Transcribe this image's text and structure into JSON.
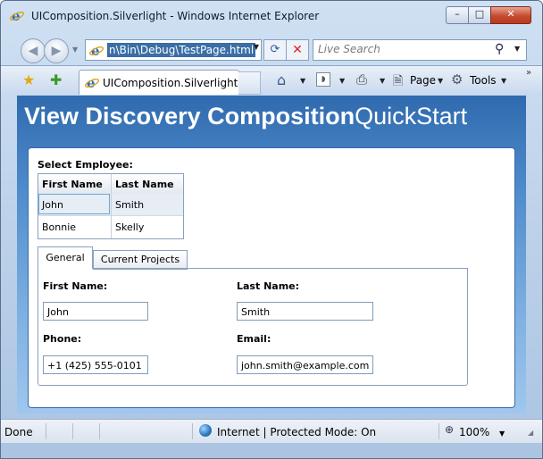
{
  "window": {
    "title": "UIComposition.Silverlight - Windows Internet Explorer",
    "controls": {
      "minimize": "–",
      "maximize": "□",
      "close": "✕"
    }
  },
  "navigation": {
    "back_glyph": "◀",
    "forward_glyph": "▶",
    "address": "n\\Bin\\Debug\\TestPage.html",
    "refresh_glyph": "⟳",
    "stop_glyph": "✕",
    "search_placeholder": "Live Search",
    "search_glyph": "⚲"
  },
  "commandbar": {
    "tab_title": "UIComposition.Silverlight",
    "page_label": "Page",
    "tools_label": "Tools",
    "more_glyph": "»"
  },
  "app": {
    "title_bold": "View Discovery Composition",
    "title_light": "QuickStart",
    "select_label": "Select Employee:",
    "grid": {
      "columns": [
        "First Name",
        "Last Name"
      ],
      "rows": [
        [
          "John",
          "Smith"
        ],
        [
          "Bonnie",
          "Skelly"
        ]
      ]
    },
    "tabs": [
      "General",
      "Current Projects"
    ],
    "form": {
      "first_name_label": "First Name:",
      "first_name_value": "John",
      "last_name_label": "Last Name:",
      "last_name_value": "Smith",
      "phone_label": "Phone:",
      "phone_value": "+1 (425) 555-0101",
      "email_label": "Email:",
      "email_value": "john.smith@example.com"
    }
  },
  "status": {
    "text": "Done",
    "zone": "Internet | Protected Mode: On",
    "zoom": "100%"
  },
  "colors": {
    "content_gradient_top": "#2f6aae",
    "content_gradient_bottom": "#9fc7ee",
    "selection": "#3a6ea5"
  }
}
